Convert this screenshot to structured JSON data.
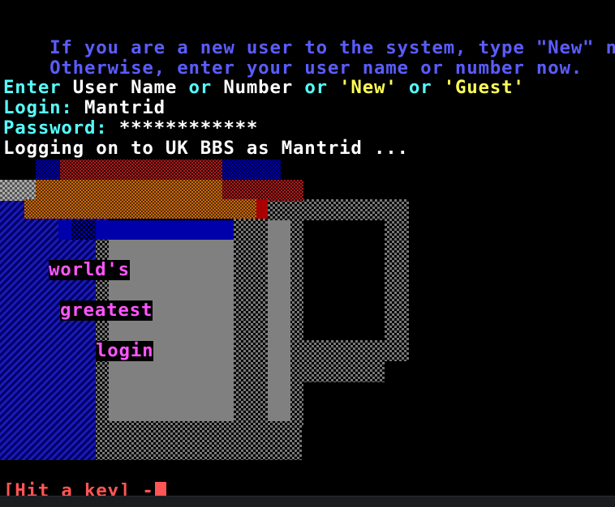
{
  "terminal": {
    "intro_line1": "If you are a new user to the system, type \"New\" now.",
    "intro_line2": "Otherwise, enter your user name or number now.",
    "prompt": {
      "enter": "Enter",
      "user_name": "User Name",
      "or1": "or",
      "number": "Number",
      "or2": "or",
      "new_opt": "'New'",
      "or3": "or",
      "guest_opt": "'Guest'"
    },
    "login_label": "Login:",
    "login_value": "Mantrid",
    "password_label": "Password:",
    "password_value": "************",
    "logging_on": "Logging on to UK BBS as Mantrid ...",
    "hit_key": "[Hit a key] -"
  },
  "art": {
    "caption1": "world's",
    "caption2": "greatest",
    "caption3": "login"
  },
  "colors": {
    "background": "#000000",
    "blue": "#5a5cff",
    "cyan": "#55ffff",
    "white": "#ffffff",
    "yellow": "#ffff55",
    "magenta": "#ff55ff",
    "red": "#ff5555",
    "mug_gray": "#808080",
    "dark_blue": "#0000aa",
    "orange": "#aa5500"
  },
  "icons": {
    "cursor": "block-cursor",
    "mug": "coffee-mug-art"
  }
}
